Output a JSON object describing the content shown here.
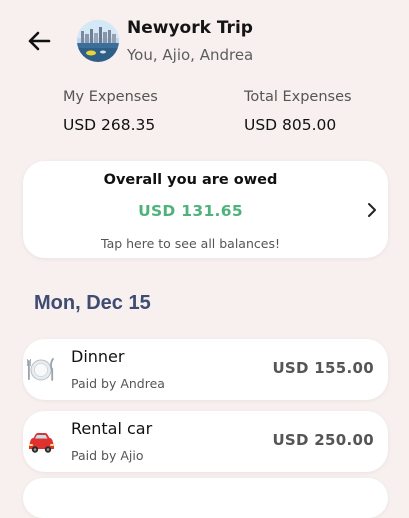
{
  "header": {
    "title": "Newyork Trip",
    "members": "You, Ajio, Andrea",
    "back_icon": "arrow-left-icon",
    "avatar_icon": "trip-photo"
  },
  "summary": {
    "my_expenses_label": "My Expenses",
    "my_expenses_value": "USD 268.35",
    "total_expenses_label": "Total Expenses",
    "total_expenses_value": "USD 805.00"
  },
  "owed_card": {
    "title": "Overall you are owed",
    "amount": "USD 131.65",
    "hint": "Tap here to see all balances!",
    "amount_color": "#4fb27b",
    "chevron_icon": "chevron-right-icon"
  },
  "date_heading": "Mon, Dec 15",
  "expenses": [
    {
      "name": "Dinner",
      "payer": "Paid by Andrea",
      "amount": "USD 155.00",
      "icon": "plate-cutlery-icon"
    },
    {
      "name": "Rental car",
      "payer": "Paid by Ajio",
      "amount": "USD 250.00",
      "icon": "red-car-icon"
    }
  ],
  "colors": {
    "background": "#f7f0ef",
    "card": "#ffffff",
    "date_heading": "#3e4b72"
  }
}
